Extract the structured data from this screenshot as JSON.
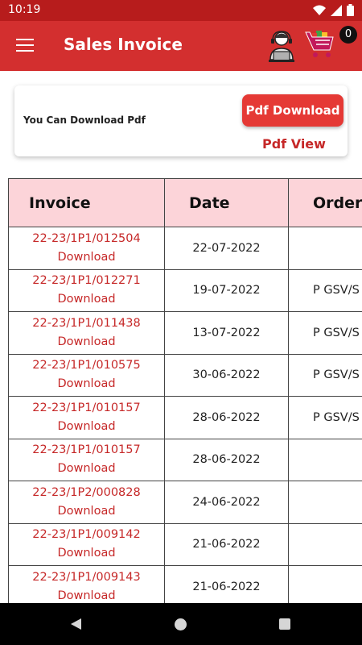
{
  "status": {
    "time": "10:19"
  },
  "app": {
    "title": "Sales Invoice",
    "cart_count": "0"
  },
  "pdf": {
    "text": "You Can Download Pdf",
    "download_label": "Pdf Download",
    "view_label": "Pdf View"
  },
  "table": {
    "headers": {
      "invoice": "Invoice",
      "date": "Date",
      "order": "Order"
    },
    "download_label": "Download",
    "rows": [
      {
        "invoice": "22-23/1P1/012504",
        "date": "22-07-2022",
        "order": ""
      },
      {
        "invoice": "22-23/1P1/012271",
        "date": "19-07-2022",
        "order": "P GSV/S"
      },
      {
        "invoice": "22-23/1P1/011438",
        "date": "13-07-2022",
        "order": "P GSV/S"
      },
      {
        "invoice": "22-23/1P1/010575",
        "date": "30-06-2022",
        "order": "P GSV/S"
      },
      {
        "invoice": "22-23/1P1/010157",
        "date": "28-06-2022",
        "order": "P GSV/S"
      },
      {
        "invoice": "22-23/1P1/010157",
        "date": "28-06-2022",
        "order": ""
      },
      {
        "invoice": "22-23/1P2/000828",
        "date": "24-06-2022",
        "order": ""
      },
      {
        "invoice": "22-23/1P1/009142",
        "date": "21-06-2022",
        "order": ""
      },
      {
        "invoice": "22-23/1P1/009143",
        "date": "21-06-2022",
        "order": ""
      }
    ]
  },
  "colors": {
    "app_bar": "#d32f2f",
    "status_bar": "#b71c1c",
    "accent": "#c62828",
    "header_bg": "#fcd4d9"
  },
  "icons": {
    "menu": "hamburger-icon",
    "support": "support-agent-icon",
    "cart": "shopping-cart-icon"
  }
}
